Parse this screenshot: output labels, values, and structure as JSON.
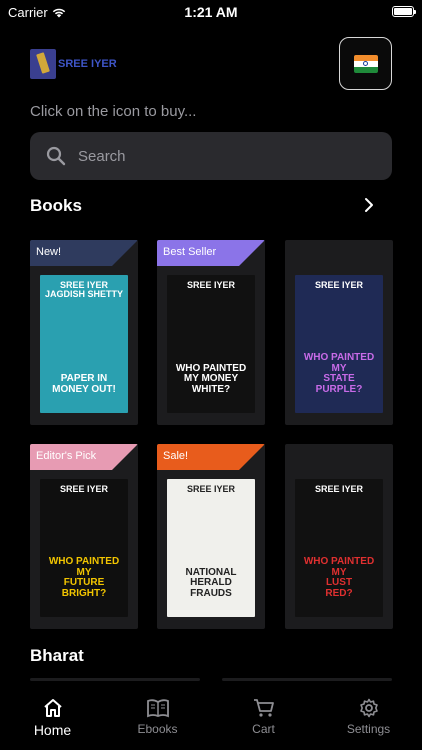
{
  "status_bar": {
    "carrier": "Carrier",
    "time": "1:21 AM"
  },
  "header": {
    "logo_text": "SREE IYER",
    "flag_icon": "india-flag-icon"
  },
  "hint": "Click on the icon to buy...",
  "search": {
    "placeholder": "Search"
  },
  "sections": {
    "books_title": "Books",
    "bharat_title": "Bharat"
  },
  "books": [
    {
      "badge": "New!",
      "badge_color": "#2f3b5e",
      "cover": {
        "author": "SREE IYER\nJAGDISH SHETTY",
        "title": "PAPER IN\nMONEY OUT!",
        "bg": "#2aa0b0"
      }
    },
    {
      "badge": "Best Seller",
      "badge_color": "#8b74e8",
      "cover": {
        "author": "SREE IYER",
        "title": "WHO PAINTED\nMY MONEY\nWHITE?",
        "bg": "#111111"
      }
    },
    {
      "badge": "",
      "badge_color": "",
      "cover": {
        "author": "SREE IYER",
        "title": "WHO PAINTED MY\nSTATE\nPURPLE?",
        "bg": "#1f2a55"
      }
    },
    {
      "badge": "Editor's Pick",
      "badge_color": "#e79bb3",
      "cover": {
        "author": "SREE IYER",
        "title": "WHO PAINTED MY\nFUTURE\nBRIGHT?",
        "bg": "#0f0f0f"
      }
    },
    {
      "badge": "Sale!",
      "badge_color": "#e85c1c",
      "cover": {
        "author": "SREE IYER",
        "title": "NATIONAL\nHERALD\nFRAUDS",
        "bg": "#f0f0ec"
      }
    },
    {
      "badge": "",
      "badge_color": "",
      "cover": {
        "author": "SREE IYER",
        "title": "WHO PAINTED MY\nLUST\nRED?",
        "bg": "#111111"
      }
    }
  ],
  "tabs": [
    {
      "label": "Home",
      "icon": "home-icon",
      "active": true
    },
    {
      "label": "Ebooks",
      "icon": "book-open-icon",
      "active": false
    },
    {
      "label": "Cart",
      "icon": "cart-icon",
      "active": false
    },
    {
      "label": "Settings",
      "icon": "gear-icon",
      "active": false
    }
  ],
  "colors": {
    "accent": "#ffffff",
    "inactive": "#8e8e93",
    "card": "#1c1c1e"
  }
}
